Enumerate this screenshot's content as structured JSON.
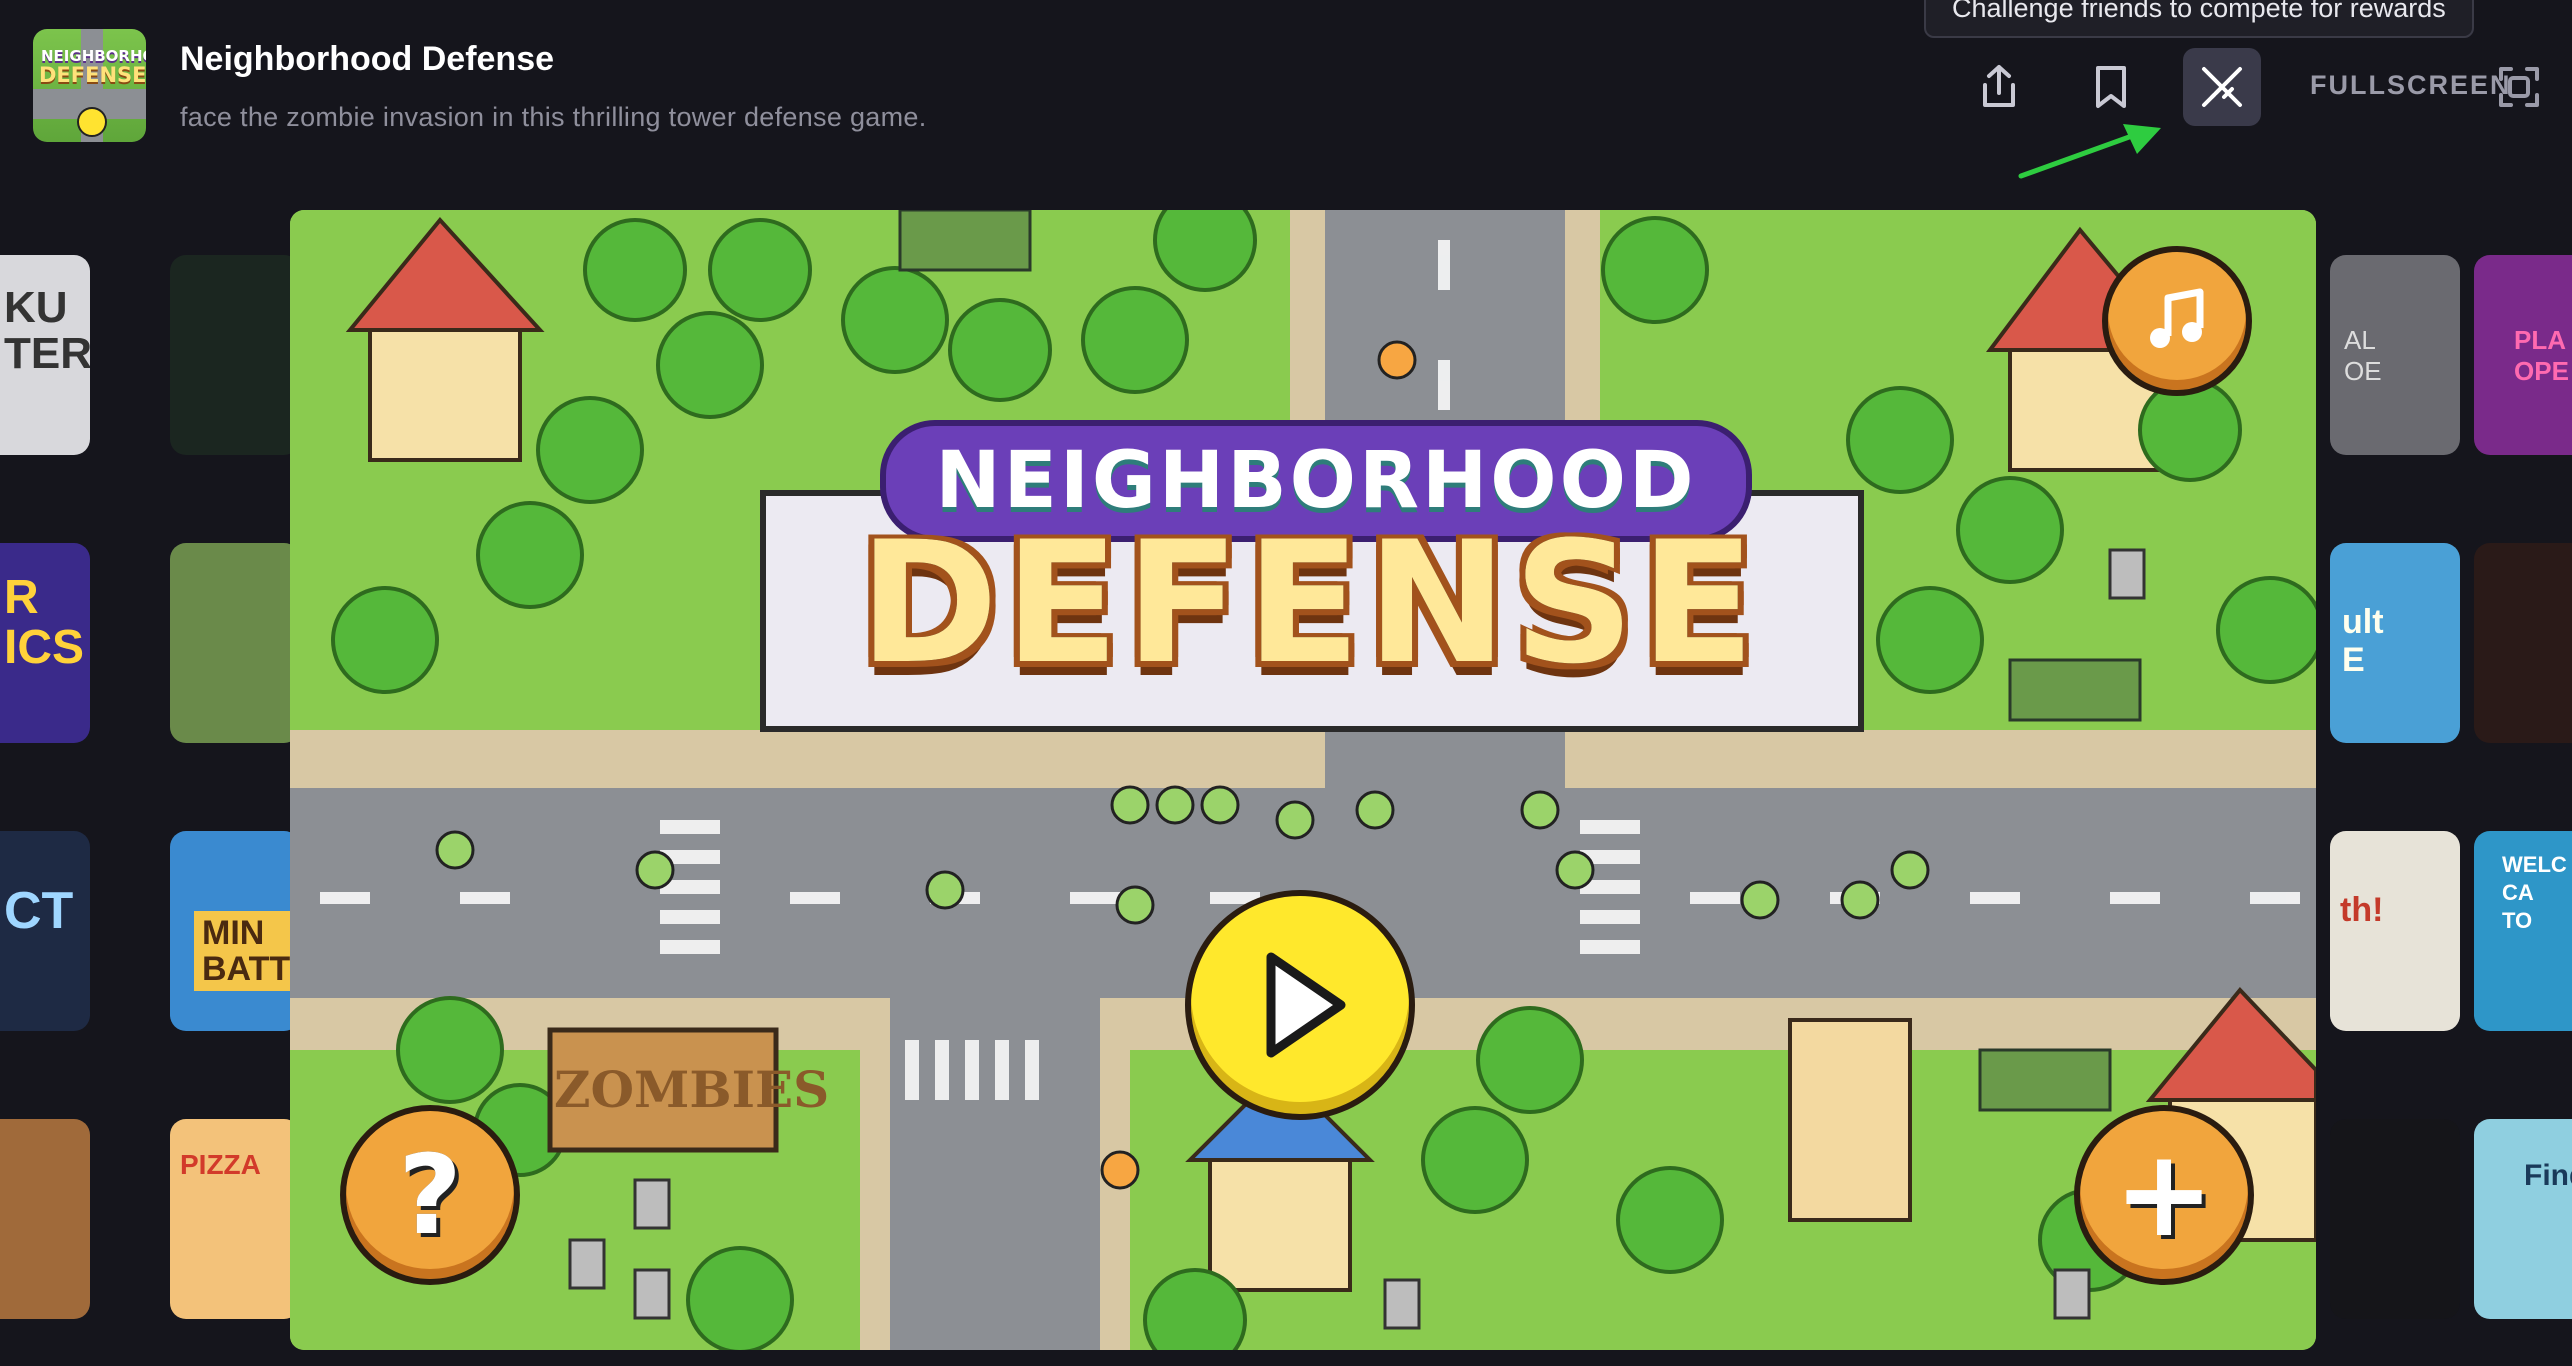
{
  "header": {
    "thumb_line1": "NEIGHBORHOOD",
    "thumb_line2": "DEFENSE",
    "title": "Neighborhood Defense",
    "description": "face the zombie invasion in this thrilling tower defense game.",
    "tooltip": "Challenge friends to compete for rewards",
    "fullscreen_label": "FULLSCREEN",
    "icons": {
      "share": "share-icon",
      "bookmark": "bookmark-icon",
      "challenge": "swords-icon",
      "fullscreen": "fullscreen-icon"
    }
  },
  "side_cards": {
    "left": [
      {
        "text": "KU\nTER"
      },
      {
        "text": "R\nICS"
      },
      {
        "text": "CT"
      },
      {
        "text": ""
      }
    ],
    "left2": [
      {
        "text": ""
      },
      {
        "text": ""
      },
      {
        "text": "MIN\nBATT"
      },
      {
        "text": "PIZZA"
      }
    ],
    "right": [
      {
        "text": "AL\nOE"
      },
      {
        "text": "ult\nE"
      },
      {
        "text": "th!"
      },
      {
        "text": ""
      }
    ],
    "right2": [
      {
        "text": "PLA\nOPE"
      },
      {
        "text": ""
      },
      {
        "text": "WELC\nCA\nTO"
      },
      {
        "text": "Find"
      }
    ]
  },
  "game": {
    "logo_top": "NEIGHBORHOOD",
    "logo_main": "DEFENSE",
    "sign_text": "ZOMBIES",
    "buttons": {
      "music": "music-note-icon",
      "play": "play-icon",
      "help": "?",
      "add": "+"
    }
  },
  "colors": {
    "background": "#15151c",
    "grass": "#8acb4f",
    "road": "#8c8f94",
    "accent_orange": "#f1a53d",
    "play_yellow": "#ffe82c",
    "hint_arrow": "#2ecc40"
  }
}
